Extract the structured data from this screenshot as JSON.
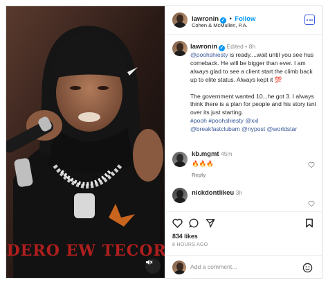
{
  "post": {
    "username": "lawronin",
    "follow_label": "Follow",
    "separator": "•",
    "location": "Cohen & McMullen, P.A."
  },
  "caption": {
    "username": "lawronin",
    "edited": "Edited",
    "separator": "•",
    "age": "8h",
    "mention_1": "@poohshiesty",
    "text_1": " is ready....wait until you see hus comeback. He will be bigger than ever. I am always glad to see a client start the climb back up to elite status. Always kept it 💯",
    "text_2": "The government wanted 10...he got 3. I always think there is a plan for people and his story isnt over its just starting.",
    "hashtags_line": [
      "#pooh",
      "#poohshiesty",
      "@xxl"
    ],
    "mentions_line": [
      "@breakfastclubam",
      "@nypost",
      "@worldstar"
    ]
  },
  "comments": [
    {
      "username": "kb.mgmt",
      "age": "45m",
      "text": "🔥🔥🔥",
      "reply_label": "Reply"
    },
    {
      "username": "nickdontlikeu",
      "age": "3h"
    }
  ],
  "stats": {
    "likes": "834 likes",
    "time": "8 HOURS AGO"
  },
  "composer": {
    "placeholder": "Add a comment..."
  },
  "icons": {
    "more": "more-options-icon",
    "like": "heart-icon",
    "comment": "comment-icon",
    "share": "share-icon",
    "save": "bookmark-icon",
    "emoji": "emoji-icon",
    "mute": "mute-icon"
  },
  "colors": {
    "accent": "#0095f6",
    "link": "#385898",
    "muted": "#8e8e8e"
  }
}
